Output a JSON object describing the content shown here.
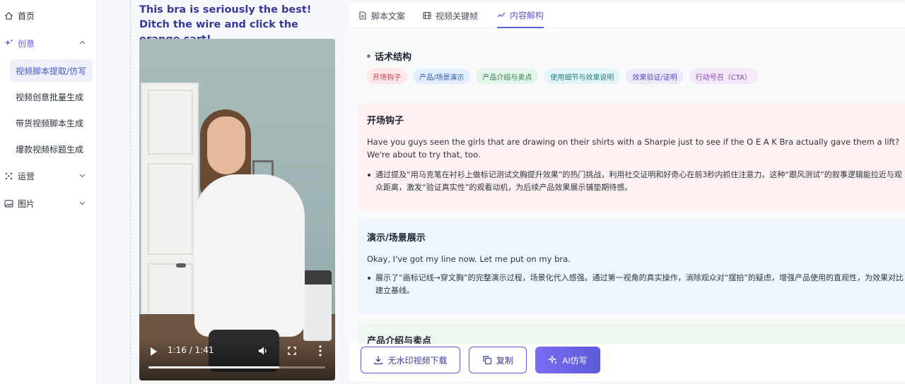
{
  "sidebar": {
    "items": [
      {
        "label": "首页",
        "icon": "home-icon"
      },
      {
        "label": "创意",
        "icon": "sparkle-icon"
      },
      {
        "label": "运营",
        "icon": "grid-icon"
      },
      {
        "label": "图片",
        "icon": "image-icon"
      }
    ],
    "sub_items": [
      {
        "label": "视频脚本提取/仿写"
      },
      {
        "label": "视频创意批量生成"
      },
      {
        "label": "带货视频脚本生成"
      },
      {
        "label": "爆款视频标题生成"
      }
    ]
  },
  "video": {
    "title": "This bra is seriously the best! Ditch the wire and click the orange cart!...",
    "time": "1:16 / 1:41",
    "progress": 0.74
  },
  "tabs": [
    {
      "label": "脚本文案",
      "icon": "document-icon"
    },
    {
      "label": "视频关键帧",
      "icon": "film-icon"
    },
    {
      "label": "内容解构",
      "icon": "trend-icon"
    }
  ],
  "structure": {
    "title": "话术结构",
    "tags": [
      {
        "label": "开场钩子",
        "bg": "#fde7e9",
        "fg": "#c23a4b"
      },
      {
        "label": "产品/场景演示",
        "bg": "#e3eefc",
        "fg": "#2f5ea8"
      },
      {
        "label": "产品介绍与卖点",
        "bg": "#e4f6ea",
        "fg": "#2e7d4a"
      },
      {
        "label": "使用细节与效果说明",
        "bg": "#e3f5f7",
        "fg": "#2a7c86"
      },
      {
        "label": "效果验证/证明",
        "bg": "#ece9fb",
        "fg": "#5b4bb8"
      },
      {
        "label": "行动号召（CTA）",
        "bg": "#f4e8fb",
        "fg": "#8a3fb3"
      }
    ]
  },
  "sections": [
    {
      "title": "开场钩子",
      "bg": "#fdf1f1",
      "en": "Have you guys seen the girls that are drawing on their shirts with a Sharpie just to see if the O E A K Bra actually gave them a lift? We're about to try that, too.",
      "analysis": "通过提及“用马克笔在衬衫上做标记测试文胸提升效果”的热门挑战，利用社交证明和好奇心在前3秒内抓住注意力。这种“跟风测试”的叙事逻辑能拉近与观众距离，激发“验证真实性”的观看动机，为后续产品效果展示铺垫期待感。"
    },
    {
      "title": "演示/场景展示",
      "bg": "#eef5fd",
      "en": "Okay, I've got my line now. Let me put on my bra.",
      "analysis": "展示了“画标记线→穿文胸”的完整演示过程，场景化代入感强。通过第一视角的真实操作，消除观众对“摆拍”的疑虑，增强产品使用的直观性，为效果对比建立基线。"
    },
    {
      "title": "产品介绍与卖点",
      "bg": "#eef8f1"
    }
  ],
  "actions": {
    "download": "无水印视频下载",
    "copy": "复制",
    "ai_rewrite": "AI仿写"
  }
}
